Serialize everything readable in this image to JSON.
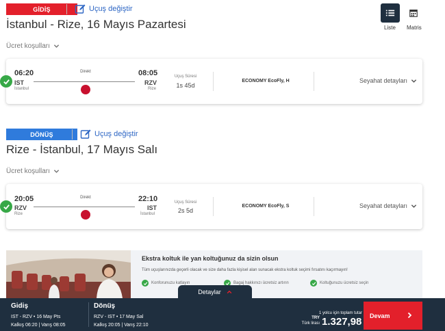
{
  "outbound": {
    "badge": "GİDİŞ",
    "change_link": "Uçuş değiştir",
    "title": "İstanbul - Rize, 16 Mayıs Pazartesi",
    "fare_conditions": "Ücret koşulları",
    "flight": {
      "dep_time": "06:20",
      "dep_code": "IST",
      "dep_city": "İstanbul",
      "arr_time": "08:05",
      "arr_code": "RZV",
      "arr_city": "Rize",
      "direct": "Direkt",
      "duration_label": "Uçuş Süresi",
      "duration": "1s 45d",
      "cabin": "ECONOMY EcoFly, H",
      "details": "Seyahat detayları"
    }
  },
  "return": {
    "badge": "DÖNÜŞ",
    "change_link": "Uçuş değiştir",
    "title": "Rize - İstanbul, 17 Mayıs Salı",
    "fare_conditions": "Ücret koşulları",
    "flight": {
      "dep_time": "20:05",
      "dep_code": "RZV",
      "dep_city": "Rize",
      "arr_time": "22:10",
      "arr_code": "IST",
      "arr_city": "İstanbul",
      "direct": "Direkt",
      "duration_label": "Uçuş Süresi",
      "duration": "2s 5d",
      "cabin": "ECONOMY EcoFly, S",
      "details": "Seyahat detayları"
    }
  },
  "view_toggle": {
    "list_label": "Liste",
    "matrix_label": "Matris",
    "active": "list"
  },
  "promo": {
    "title": "Ekstra koltuk ile yan koltuğunuz da sizin olsun",
    "desc": "Tüm uçuşlarınızda geçerli olacak ve size daha fazla kişisel alan sunacak ekstra koltuk seçimi fırsatını kaçırmayın!",
    "features": [
      "Konforunuzu katlayın",
      "Bagaj hakkınızı ücretsiz artırın",
      "Koltuğunuzu ücretsiz seçin"
    ]
  },
  "footer": {
    "details_tab": "Detaylar",
    "outbound_title": "Gidiş",
    "outbound_line1": "IST - RZV  •  16 May Pts",
    "outbound_line2": "Kalkış 06:20 | Varış 08:05",
    "return_title": "Dönüş",
    "return_line1": "RZV - IST  •  17 May Sal",
    "return_line2": "Kalkış 20:05 | Varış 22:10",
    "total_label": "1 yolcu için toplam tutar",
    "currency": "TRY",
    "currency_name": "Türk lirası",
    "amount": "1.327,98",
    "continue": "Devam"
  },
  "colors": {
    "red": "#e3202b",
    "blue": "#2f7bdc",
    "navy": "#1f2f3f",
    "green": "#37a847",
    "link": "#2d66c4"
  }
}
